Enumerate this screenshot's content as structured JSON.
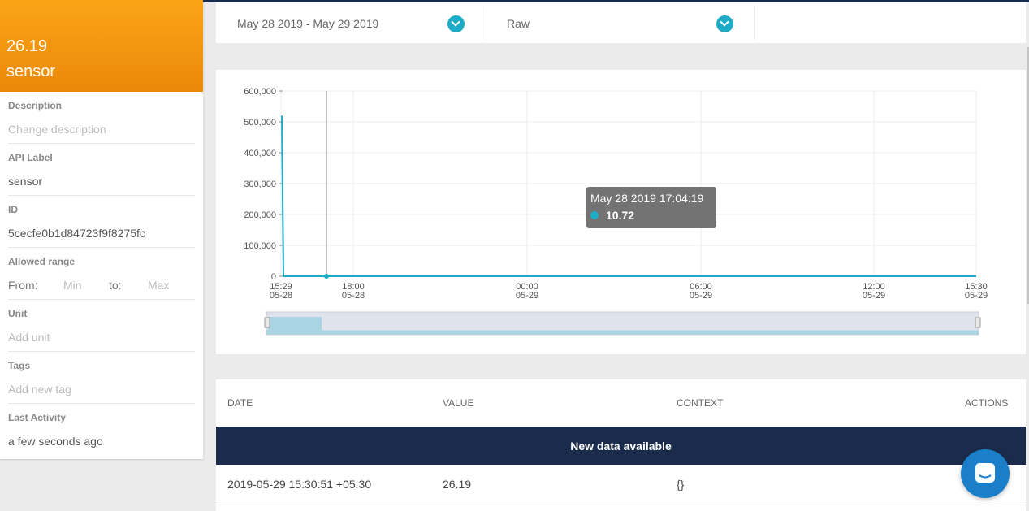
{
  "variable": {
    "last_value": "26.19",
    "name": "sensor"
  },
  "properties": {
    "description": {
      "label": "Description",
      "placeholder": "Change description"
    },
    "api_label": {
      "label": "API Label",
      "value": "sensor"
    },
    "id": {
      "label": "ID",
      "value": "5cecfe0b1d84723f9f8275fc"
    },
    "range": {
      "label": "Allowed range",
      "from_label": "From:",
      "min_placeholder": "Min",
      "to_label": "to:",
      "max_placeholder": "Max"
    },
    "unit": {
      "label": "Unit",
      "placeholder": "Add unit"
    },
    "tags": {
      "label": "Tags",
      "placeholder": "Add new tag"
    },
    "last_activity": {
      "label": "Last Activity",
      "value": "a few seconds ago"
    }
  },
  "filters": {
    "date_range": "May 28 2019 - May 29 2019",
    "aggregation": "Raw"
  },
  "chart_data": {
    "type": "line",
    "y_ticks": [
      "600,000",
      "500,000",
      "400,000",
      "300,000",
      "200,000",
      "100,000",
      "0"
    ],
    "x_ticks": [
      {
        "time": "15:29",
        "date": "05-28"
      },
      {
        "time": "18:00",
        "date": "05-28"
      },
      {
        "time": "00:00",
        "date": "05-29"
      },
      {
        "time": "06:00",
        "date": "05-29"
      },
      {
        "time": "12:00",
        "date": "05-29"
      },
      {
        "time": "15:30",
        "date": "05-29"
      }
    ],
    "ylim": [
      0,
      600000
    ],
    "series": [
      {
        "color": "#1dabc7",
        "points": [
          [
            "2019-05-28 15:29",
            520000
          ],
          [
            "2019-05-28 15:31",
            0
          ],
          [
            "2019-05-28 17:04:19",
            10.72
          ],
          [
            "2019-05-29 15:30:51",
            26.19
          ]
        ]
      }
    ],
    "grid": true
  },
  "tooltip": {
    "date": "May 28 2019 17:04:19",
    "value": "10.72"
  },
  "table": {
    "headers": {
      "date": "DATE",
      "value": "VALUE",
      "context": "CONTEXT",
      "actions": "ACTIONS"
    },
    "banner": "New data available",
    "rows": [
      {
        "date": "2019-05-29 15:30:51 +05:30",
        "value": "26.19",
        "context": "{}"
      }
    ]
  }
}
